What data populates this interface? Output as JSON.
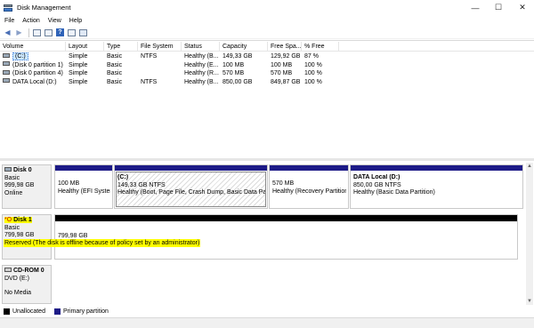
{
  "window": {
    "title": "Disk Management",
    "controls": [
      "—",
      "☐",
      "✕"
    ]
  },
  "menu": [
    "File",
    "Action",
    "View",
    "Help"
  ],
  "toolbar": {
    "icons": [
      "back-arrow-icon",
      "forward-arrow-icon",
      "console-tree-icon",
      "properties-icon",
      "help-icon",
      "disk-list-icon",
      "rescan-icon"
    ],
    "help_glyph": "?"
  },
  "volume_table": {
    "columns": [
      "Volume",
      "Layout",
      "Type",
      "File System",
      "Status",
      "Capacity",
      "Free Spa...",
      "% Free"
    ],
    "rows": [
      {
        "volume": "(C:)",
        "layout": "Simple",
        "type": "Basic",
        "fs": "NTFS",
        "status": "Healthy (B...",
        "capacity": "149,33 GB",
        "free": "129,92 GB",
        "pct": "87 %",
        "selected": true
      },
      {
        "volume": "(Disk 0 partition 1)",
        "layout": "Simple",
        "type": "Basic",
        "fs": "",
        "status": "Healthy (E...",
        "capacity": "100 MB",
        "free": "100 MB",
        "pct": "100 %",
        "selected": false
      },
      {
        "volume": "(Disk 0 partition 4)",
        "layout": "Simple",
        "type": "Basic",
        "fs": "",
        "status": "Healthy (R...",
        "capacity": "570 MB",
        "free": "570 MB",
        "pct": "100 %",
        "selected": false
      },
      {
        "volume": "DATA Local (D:)",
        "layout": "Simple",
        "type": "Basic",
        "fs": "NTFS",
        "status": "Healthy (B...",
        "capacity": "850,00 GB",
        "free": "849,87 GB",
        "pct": "100 %",
        "selected": false
      }
    ]
  },
  "disks": {
    "disk0": {
      "name": "Disk 0",
      "type": "Basic",
      "size": "999,98 GB",
      "state": "Online",
      "partitions": [
        {
          "title": "",
          "size": "100 MB",
          "status": "Healthy (EFI System"
        },
        {
          "title": "(C:)",
          "size": "149,33 GB NTFS",
          "status": "Healthy (Boot, Page File, Crash Dump, Basic Data Partit"
        },
        {
          "title": "",
          "size": "570 MB",
          "status": "Healthy (Recovery Partition)"
        },
        {
          "title": "DATA Local  (D:)",
          "size": "850,00 GB NTFS",
          "status": "Healthy (Basic Data Partition)"
        }
      ]
    },
    "disk1": {
      "name": "Disk 1",
      "prefix": "*O",
      "type": "Basic",
      "size": "799,98 GB",
      "state": "Reserved (The disk is offline because of policy set by an administrator)",
      "partition_size": "799,98 GB"
    },
    "cdrom0": {
      "name": "CD-ROM 0",
      "drive": "DVD (E:)",
      "media": "No Media"
    }
  },
  "legend": [
    {
      "label": "Unallocated",
      "color": "#000000"
    },
    {
      "label": "Primary partition",
      "color": "#1d1b87"
    }
  ],
  "colors": {
    "primary_partition": "#1d1b87",
    "unallocated": "#000000",
    "highlight": "#ffff00",
    "selection": "#cce8ff"
  }
}
